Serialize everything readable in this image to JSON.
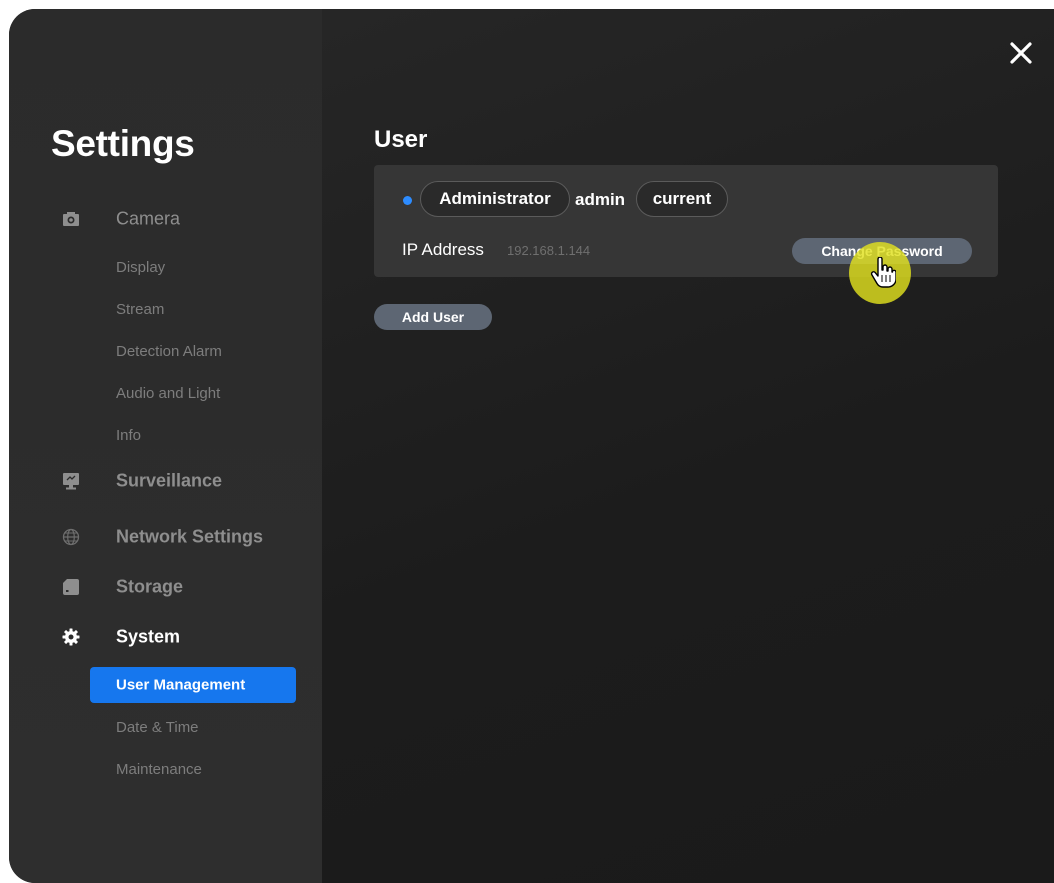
{
  "sidebar": {
    "title": "Settings",
    "sections": [
      {
        "label": "Camera",
        "icon": "camera-icon",
        "subitems": [
          "Display",
          "Stream",
          "Detection Alarm",
          "Audio and Light",
          "Info"
        ]
      },
      {
        "label": "Surveillance",
        "icon": "monitor-icon"
      },
      {
        "label": "Network Settings",
        "icon": "globe-icon"
      },
      {
        "label": "Storage",
        "icon": "sd-card-icon"
      },
      {
        "label": "System",
        "icon": "gear-icon",
        "active": true,
        "subitems": [
          "User Management",
          "Date & Time",
          "Maintenance"
        ],
        "active_subitem": "User Management"
      }
    ]
  },
  "main": {
    "title": "User",
    "user": {
      "role": "Administrator",
      "username": "admin",
      "status": "current",
      "ip_label": "IP Address",
      "ip_value": "192.168.1.144",
      "change_password_label": "Change Password"
    },
    "add_user_label": "Add User"
  },
  "colors": {
    "accent": "#1677ee",
    "status_dot": "#2d8cff",
    "button_grey": "#5d6673",
    "sidebar_bg": "#2b2b2b",
    "main_bg": "#1d1d1d",
    "cursor_highlight": "#e0e01e"
  }
}
